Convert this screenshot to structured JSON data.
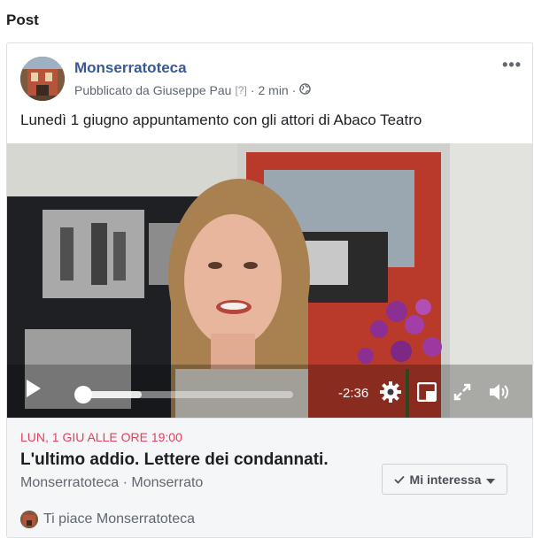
{
  "section": {
    "title": "Post"
  },
  "post": {
    "page_name": "Monserratoteca",
    "published_by": "Pubblicato da Giuseppe Pau",
    "help": "[?]",
    "separator": "·",
    "time": "2 min",
    "text": "Lunedì 1 giugno appuntamento con gli attori di Abaco Teatro",
    "more_icon": "more-options-icon"
  },
  "video": {
    "progress": 0.28,
    "remaining": "-2:36",
    "icons": [
      "play-icon",
      "settings-icon",
      "miniplayer-icon",
      "fullscreen-icon",
      "volume-icon"
    ]
  },
  "event": {
    "date": "LUN, 1 GIU ALLE ORE 19:00",
    "title": "L'ultimo addio. Lettere dei condannati.",
    "location": "Monserratoteca · Monserrato",
    "interest_label": "Mi interessa",
    "likes_text": "Ti piace Monserratoteca"
  },
  "colors": {
    "brand_link": "#385898",
    "event_date": "#e4405f"
  }
}
